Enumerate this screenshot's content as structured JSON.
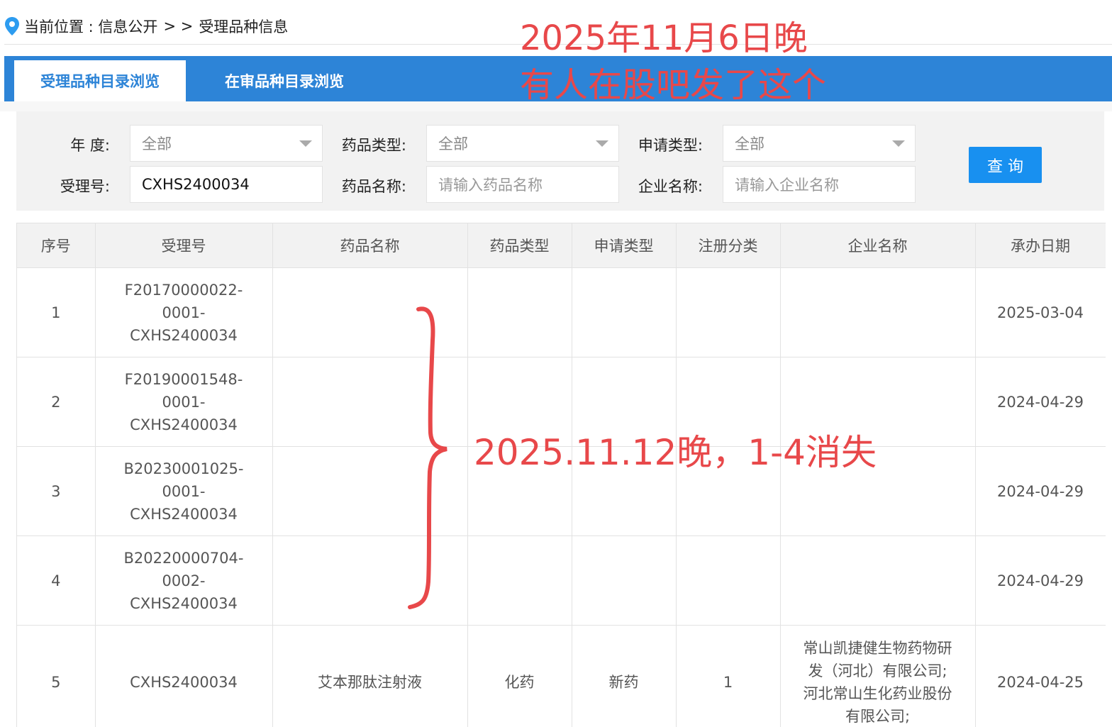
{
  "breadcrumb": {
    "prefix": "当前位置 : 信息公开",
    "separator": "> >",
    "current": "受理品种信息"
  },
  "tabs": [
    {
      "label": "受理品种目录浏览",
      "active": true
    },
    {
      "label": "在审品种目录浏览",
      "active": false
    }
  ],
  "filters": {
    "year_label": "年   度:",
    "year_value": "全部",
    "drug_type_label": "药品类型:",
    "drug_type_value": "全部",
    "apply_type_label": "申请类型:",
    "apply_type_value": "全部",
    "accept_no_label": "受理号:",
    "accept_no_value": "CXHS2400034",
    "drug_name_label": "药品名称:",
    "drug_name_placeholder": "请输入药品名称",
    "company_label": "企业名称:",
    "company_placeholder": "请输入企业名称",
    "query_button": "查 询"
  },
  "table": {
    "headers": [
      "序号",
      "受理号",
      "药品名称",
      "药品类型",
      "申请类型",
      "注册分类",
      "企业名称",
      "承办日期"
    ],
    "rows": [
      {
        "no": "1",
        "accept_lines": [
          "F20170000022-",
          "0001-",
          "CXHS2400034"
        ],
        "drug_name": "",
        "drug_type": "",
        "apply_type": "",
        "reg_class": "",
        "company_lines": [],
        "date": "2025-03-04"
      },
      {
        "no": "2",
        "accept_lines": [
          "F20190001548-",
          "0001-",
          "CXHS2400034"
        ],
        "drug_name": "",
        "drug_type": "",
        "apply_type": "",
        "reg_class": "",
        "company_lines": [],
        "date": "2024-04-29"
      },
      {
        "no": "3",
        "accept_lines": [
          "B20230001025-",
          "0001-",
          "CXHS2400034"
        ],
        "drug_name": "",
        "drug_type": "",
        "apply_type": "",
        "reg_class": "",
        "company_lines": [],
        "date": "2024-04-29"
      },
      {
        "no": "4",
        "accept_lines": [
          "B20220000704-",
          "0002-",
          "CXHS2400034"
        ],
        "drug_name": "",
        "drug_type": "",
        "apply_type": "",
        "reg_class": "",
        "company_lines": [],
        "date": "2024-04-29"
      },
      {
        "no": "5",
        "accept_lines": [
          "CXHS2400034"
        ],
        "drug_name": "艾本那肽注射液",
        "drug_type": "化药",
        "apply_type": "新药",
        "reg_class": "1",
        "company_lines": [
          "常山凯捷健生物药物研",
          "发（河北）有限公司;",
          "河北常山生化药业股份",
          "有限公司;"
        ],
        "date": "2024-04-25"
      }
    ]
  },
  "annotations": {
    "line1": "2025年11月6日晚",
    "line2": "有人在股吧发了这个",
    "line3": "2025.11.12晚，1-4消失"
  },
  "colors": {
    "accent": "#2d84d7",
    "button": "#1890f0",
    "annotation": "#e8484a"
  }
}
